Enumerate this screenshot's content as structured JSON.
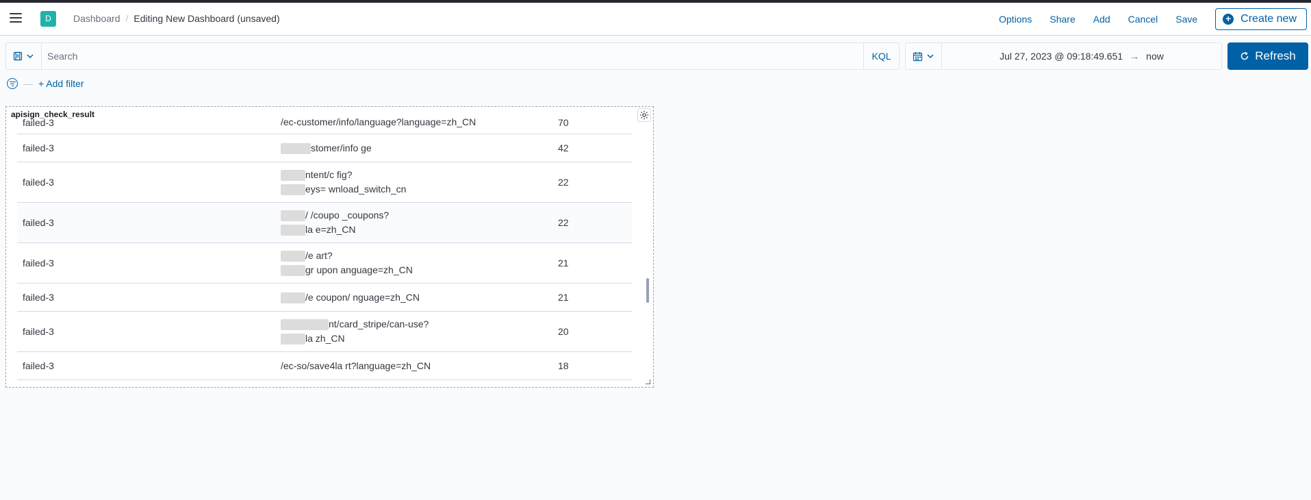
{
  "header": {
    "space_initial": "D",
    "breadcrumbs": [
      "Dashboard",
      "Editing New Dashboard (unsaved)"
    ],
    "actions": [
      "Options",
      "Share",
      "Add",
      "Cancel",
      "Save"
    ],
    "create_new_label": "Create new"
  },
  "query": {
    "search_placeholder": "Search",
    "language_label": "KQL"
  },
  "time": {
    "start": "Jul 27, 2023 @ 09:18:49.651",
    "arrow": "→",
    "end": "now",
    "refresh_label": "Refresh"
  },
  "filters": {
    "add_filter_label": "+ Add filter"
  },
  "panel": {
    "title": "apisign_check_result",
    "rows": [
      {
        "status": "failed-3",
        "path_lines": [
          "/ec-customer/info/language?language=zh_CN"
        ],
        "count": "70"
      },
      {
        "status": "failed-3",
        "path_lines": [
          "stomer/info ge"
        ],
        "count": "42"
      },
      {
        "status": "failed-3",
        "path_lines": [
          "ntent/c fig?",
          "eys= wnload_switch_cn"
        ],
        "count": "22"
      },
      {
        "status": "failed-3",
        "path_lines": [
          "/ /coupo _coupons?",
          "la e=zh_CN"
        ],
        "count": "22"
      },
      {
        "status": "failed-3",
        "path_lines": [
          "/e art?",
          "gr upon anguage=zh_CN"
        ],
        "count": "21"
      },
      {
        "status": "failed-3",
        "path_lines": [
          "/e coupon/ nguage=zh_CN"
        ],
        "count": "21"
      },
      {
        "status": "failed-3",
        "path_lines": [
          "nt/card_stripe/can-use?",
          "la zh_CN"
        ],
        "count": "20"
      },
      {
        "status": "failed-3",
        "path_lines": [
          "/ec-so/save4la rt?language=zh_CN"
        ],
        "count": "18"
      }
    ]
  },
  "colors": {
    "accent": "#0061a6",
    "space_avatar": "#20b2a8",
    "topbar": "#25282f"
  }
}
